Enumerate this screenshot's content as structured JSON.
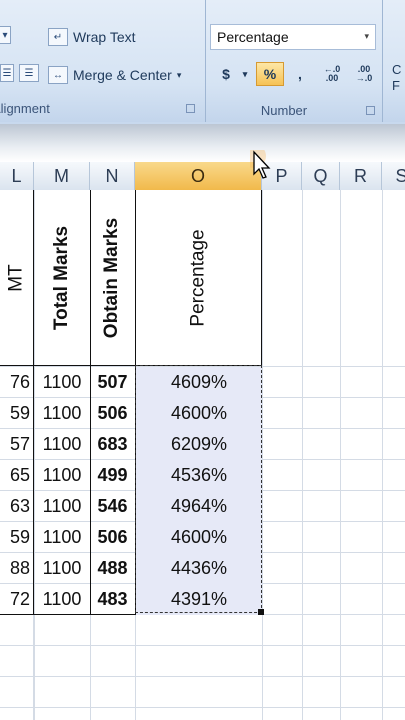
{
  "ribbon": {
    "alignment": {
      "wrap_text": "Wrap Text",
      "merge_center": "Merge & Center",
      "group_label": "Alignment"
    },
    "number": {
      "format_value": "Percentage",
      "currency_symbol": "$",
      "percent_symbol": "%",
      "comma_symbol": ",",
      "increase_decimal": "←.0 .00",
      "decrease_decimal": ".00 →.0",
      "group_label": "Number"
    },
    "styles_partial": "C\nF"
  },
  "columns": [
    "L",
    "M",
    "N",
    "O",
    "P",
    "Q",
    "R",
    "S"
  ],
  "selected_column": "O",
  "headers": {
    "L": "MT",
    "M": "Total Marks",
    "N": "Obtain Marks",
    "O": "Percentage"
  },
  "rows": [
    {
      "L": "76",
      "M": "1100",
      "N": "507",
      "O": "4609%"
    },
    {
      "L": "59",
      "M": "1100",
      "N": "506",
      "O": "4600%"
    },
    {
      "L": "57",
      "M": "1100",
      "N": "683",
      "O": "6209%"
    },
    {
      "L": "65",
      "M": "1100",
      "N": "499",
      "O": "4536%"
    },
    {
      "L": "63",
      "M": "1100",
      "N": "546",
      "O": "4964%"
    },
    {
      "L": "59",
      "M": "1100",
      "N": "506",
      "O": "4600%"
    },
    {
      "L": "88",
      "M": "1100",
      "N": "488",
      "O": "4436%"
    },
    {
      "L": "72",
      "M": "1100",
      "N": "483",
      "O": "4391%"
    }
  ],
  "colors": {
    "selection_fill": "#e6e9f7",
    "column_highlight": "#f1b94b",
    "ribbon_bg": "#d5e3f3"
  }
}
